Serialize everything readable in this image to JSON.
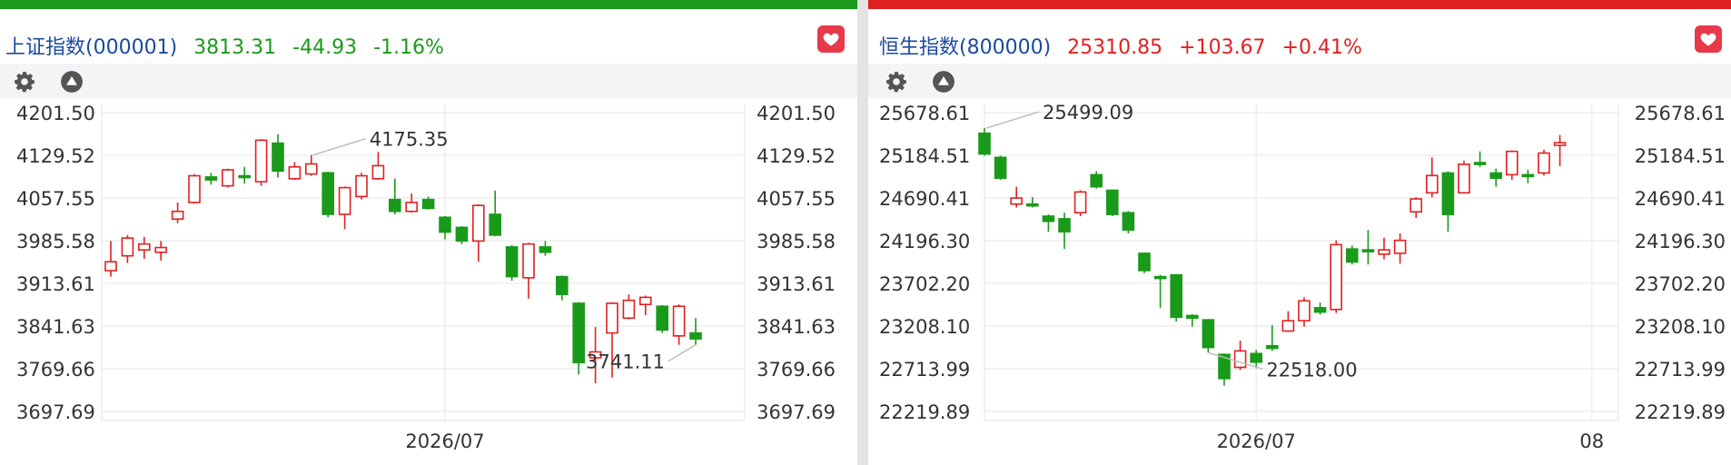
{
  "colors": {
    "up": "#e02020",
    "down": "#1a9a1a",
    "name": "#1a4aa0",
    "grid": "#e6e6e6",
    "axis_text": "#333333",
    "fav": "#e8394b"
  },
  "left_panel": {
    "index_name": "上证指数(000001)",
    "price": "3813.31",
    "change": "-44.93",
    "change_pct": "-1.16%",
    "trend": "down",
    "settings_icon": "gear-icon",
    "collapse_icon": "triangle-up-icon",
    "favorite_icon": "heart-icon"
  },
  "right_panel": {
    "index_name": "恒生指数(800000)",
    "price": "25310.85",
    "change": "+103.67",
    "change_pct": "+0.41%",
    "trend": "up",
    "settings_icon": "gear-icon",
    "collapse_icon": "triangle-up-icon",
    "favorite_icon": "heart-icon"
  },
  "chart_data": [
    {
      "type": "candlestick",
      "title": "上证指数(000001)",
      "y_ticks": [
        "4201.50",
        "4129.52",
        "4057.55",
        "3985.58",
        "3913.61",
        "3841.63",
        "3769.66",
        "3697.69"
      ],
      "ylim": [
        3697.69,
        4201.5
      ],
      "x_labels": [
        {
          "index": 20,
          "label": "2026/07"
        }
      ],
      "annotations": [
        {
          "text": "4175.35",
          "type": "max",
          "candle_index": 12
        },
        {
          "text": "3741.11",
          "type": "min",
          "candle_index": 35
        }
      ],
      "grid": true,
      "series": [
        {
          "o": 3935,
          "c": 3950,
          "h": 3985,
          "l": 3925
        },
        {
          "o": 3960,
          "c": 3990,
          "h": 3995,
          "l": 3948
        },
        {
          "o": 3970,
          "c": 3980,
          "h": 3992,
          "l": 3955
        },
        {
          "o": 3966,
          "c": 3974,
          "h": 3985,
          "l": 3952
        },
        {
          "o": 4022,
          "c": 4035,
          "h": 4050,
          "l": 4015
        },
        {
          "o": 4050,
          "c": 4095,
          "h": 4098,
          "l": 4048
        },
        {
          "o": 4093,
          "c": 4088,
          "h": 4100,
          "l": 4080
        },
        {
          "o": 4078,
          "c": 4105,
          "h": 4107,
          "l": 4075
        },
        {
          "o": 4095,
          "c": 4092,
          "h": 4110,
          "l": 4082
        },
        {
          "o": 4085,
          "c": 4155,
          "h": 4157,
          "l": 4078
        },
        {
          "o": 4150,
          "c": 4103,
          "h": 4165,
          "l": 4092
        },
        {
          "o": 4090,
          "c": 4110,
          "h": 4118,
          "l": 4088
        },
        {
          "o": 4098,
          "c": 4115,
          "h": 4130,
          "l": 4095
        },
        {
          "o": 4100,
          "c": 4030,
          "h": 4102,
          "l": 4025
        },
        {
          "o": 4030,
          "c": 4075,
          "h": 4077,
          "l": 4005
        },
        {
          "o": 4060,
          "c": 4095,
          "h": 4100,
          "l": 4055
        },
        {
          "o": 4090,
          "c": 4112,
          "h": 4135,
          "l": 4088
        },
        {
          "o": 4055,
          "c": 4035,
          "h": 4090,
          "l": 4030
        },
        {
          "o": 4035,
          "c": 4050,
          "h": 4065,
          "l": 4033
        },
        {
          "o": 4055,
          "c": 4040,
          "h": 4060,
          "l": 4038
        },
        {
          "o": 4025,
          "c": 4000,
          "h": 4027,
          "l": 3988
        },
        {
          "o": 4008,
          "c": 3985,
          "h": 4010,
          "l": 3980
        },
        {
          "o": 3985,
          "c": 4045,
          "h": 4047,
          "l": 3950
        },
        {
          "o": 4030,
          "c": 3995,
          "h": 4070,
          "l": 3993
        },
        {
          "o": 3975,
          "c": 3925,
          "h": 3978,
          "l": 3918
        },
        {
          "o": 3923,
          "c": 3980,
          "h": 3982,
          "l": 3888
        },
        {
          "o": 3975,
          "c": 3966,
          "h": 3985,
          "l": 3960
        },
        {
          "o": 3925,
          "c": 3895,
          "h": 3927,
          "l": 3885
        },
        {
          "o": 3880,
          "c": 3780,
          "h": 3882,
          "l": 3760
        },
        {
          "o": 3788,
          "c": 3798,
          "h": 3840,
          "l": 3745
        },
        {
          "o": 3830,
          "c": 3880,
          "h": 3882,
          "l": 3755
        },
        {
          "o": 3855,
          "c": 3885,
          "h": 3895,
          "l": 3853
        },
        {
          "o": 3878,
          "c": 3890,
          "h": 3893,
          "l": 3860
        },
        {
          "o": 3875,
          "c": 3835,
          "h": 3877,
          "l": 3830
        },
        {
          "o": 3825,
          "c": 3875,
          "h": 3878,
          "l": 3810
        },
        {
          "o": 3830,
          "c": 3820,
          "h": 3855,
          "l": 3810
        }
      ]
    },
    {
      "type": "candlestick",
      "title": "恒生指数(800000)",
      "y_ticks": [
        "25678.61",
        "25184.51",
        "24690.41",
        "24196.30",
        "23702.20",
        "23208.10",
        "22713.99",
        "22219.89"
      ],
      "ylim": [
        22219.89,
        25678.61
      ],
      "x_labels": [
        {
          "index": 17,
          "label": "2026/07"
        },
        {
          "index": 38,
          "label": "08"
        }
      ],
      "annotations": [
        {
          "text": "25499.09",
          "type": "max",
          "candle_index": 0
        },
        {
          "text": "22518.00",
          "type": "min",
          "candle_index": 14
        }
      ],
      "grid": true,
      "series": [
        {
          "o": 25440,
          "c": 25200,
          "h": 25499,
          "l": 25180
        },
        {
          "o": 25160,
          "c": 24920,
          "h": 25180,
          "l": 24900
        },
        {
          "o": 24620,
          "c": 24690,
          "h": 24820,
          "l": 24580
        },
        {
          "o": 24620,
          "c": 24600,
          "h": 24700,
          "l": 24580
        },
        {
          "o": 24480,
          "c": 24420,
          "h": 24500,
          "l": 24300
        },
        {
          "o": 24450,
          "c": 24300,
          "h": 24520,
          "l": 24100
        },
        {
          "o": 24520,
          "c": 24760,
          "h": 24780,
          "l": 24480
        },
        {
          "o": 24960,
          "c": 24820,
          "h": 25000,
          "l": 24800
        },
        {
          "o": 24780,
          "c": 24500,
          "h": 24790,
          "l": 24480
        },
        {
          "o": 24520,
          "c": 24320,
          "h": 24540,
          "l": 24280
        },
        {
          "o": 24050,
          "c": 23850,
          "h": 24060,
          "l": 23820
        },
        {
          "o": 23780,
          "c": 23760,
          "h": 23800,
          "l": 23420
        },
        {
          "o": 23800,
          "c": 23310,
          "h": 23810,
          "l": 23260
        },
        {
          "o": 23330,
          "c": 23300,
          "h": 23345,
          "l": 23200
        },
        {
          "o": 23280,
          "c": 22960,
          "h": 23290,
          "l": 22900
        },
        {
          "o": 22880,
          "c": 22600,
          "h": 22890,
          "l": 22518
        },
        {
          "o": 22730,
          "c": 22920,
          "h": 23040,
          "l": 22700
        },
        {
          "o": 22890,
          "c": 22790,
          "h": 22930,
          "l": 22720
        },
        {
          "o": 22980,
          "c": 22950,
          "h": 23220,
          "l": 22920
        },
        {
          "o": 23150,
          "c": 23270,
          "h": 23380,
          "l": 23140
        },
        {
          "o": 23270,
          "c": 23500,
          "h": 23540,
          "l": 23200
        },
        {
          "o": 23420,
          "c": 23370,
          "h": 23480,
          "l": 23340
        },
        {
          "o": 23400,
          "c": 24150,
          "h": 24200,
          "l": 23360
        },
        {
          "o": 24100,
          "c": 23950,
          "h": 24140,
          "l": 23920
        },
        {
          "o": 24090,
          "c": 24080,
          "h": 24320,
          "l": 23920
        },
        {
          "o": 24040,
          "c": 24090,
          "h": 24230,
          "l": 23980
        },
        {
          "o": 24050,
          "c": 24200,
          "h": 24280,
          "l": 23930
        },
        {
          "o": 24530,
          "c": 24680,
          "h": 24700,
          "l": 24460
        },
        {
          "o": 24750,
          "c": 24950,
          "h": 25160,
          "l": 24700
        },
        {
          "o": 24980,
          "c": 24500,
          "h": 25000,
          "l": 24300
        },
        {
          "o": 24750,
          "c": 25080,
          "h": 25120,
          "l": 24740
        },
        {
          "o": 25100,
          "c": 25090,
          "h": 25230,
          "l": 25050
        },
        {
          "o": 24980,
          "c": 24920,
          "h": 25030,
          "l": 24820
        },
        {
          "o": 24960,
          "c": 25230,
          "h": 25240,
          "l": 24900
        },
        {
          "o": 24960,
          "c": 24940,
          "h": 25020,
          "l": 24860
        },
        {
          "o": 24980,
          "c": 25210,
          "h": 25250,
          "l": 24950
        },
        {
          "o": 25300,
          "c": 25330,
          "h": 25420,
          "l": 25060
        }
      ]
    }
  ]
}
